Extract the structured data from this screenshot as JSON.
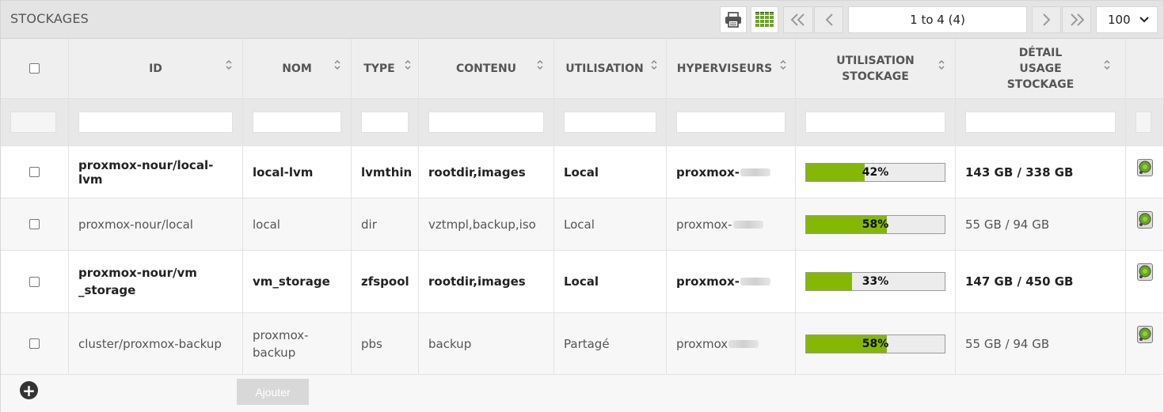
{
  "title": "STOCKAGES",
  "toolbar": {
    "print_icon": "printer-icon",
    "columns_icon": "column-grid-icon",
    "first_icon": "double-chevron-left-icon",
    "prev_icon": "chevron-left-icon",
    "next_icon": "chevron-right-icon",
    "last_icon": "double-chevron-right-icon",
    "page_info": "1 to 4 (4)",
    "page_size": "100"
  },
  "columns": [
    {
      "label": "ID"
    },
    {
      "label": "NOM"
    },
    {
      "label": "TYPE"
    },
    {
      "label": "CONTENU"
    },
    {
      "label": "UTILISATION"
    },
    {
      "label": "HYPERVISEURS"
    },
    {
      "label": "UTILISATION STOCKAGE"
    },
    {
      "label": "DÉTAIL USAGE STOCKAGE"
    }
  ],
  "rows": [
    {
      "id": "proxmox-nour/local-lvm",
      "nom": "local-lvm",
      "type": "lvmthin",
      "contenu": "rootdir,images",
      "utilisation": "Local",
      "hyperviseur": "proxmox-",
      "usage_pct": 42,
      "usage_label": "42%",
      "detail": "143 GB / 338 GB"
    },
    {
      "id": "proxmox-nour/local",
      "nom": "local",
      "type": "dir",
      "contenu": "vztmpl,backup,iso",
      "utilisation": "Local",
      "hyperviseur": "proxmox-",
      "usage_pct": 58,
      "usage_label": "58%",
      "detail": "55 GB / 94 GB"
    },
    {
      "id": "proxmox-nour/vm_storage",
      "nom": "vm_storage",
      "type": "zfspool",
      "contenu": "rootdir,images",
      "utilisation": "Local",
      "hyperviseur": "proxmox-",
      "usage_pct": 33,
      "usage_label": "33%",
      "detail": "147 GB / 450 GB"
    },
    {
      "id": "cluster/proxmox-backup",
      "nom": "proxmox-backup",
      "type": "pbs",
      "contenu": "backup",
      "utilisation": "Partagé",
      "hyperviseur": "proxmox",
      "usage_pct": 58,
      "usage_label": "58%",
      "detail": "55 GB / 94 GB"
    }
  ],
  "footer": {
    "add_icon": "plus-circle-icon",
    "add_label": "Ajouter"
  },
  "colors": {
    "bar_fill": "#84b805",
    "header_bg": "#e4e4e4"
  }
}
